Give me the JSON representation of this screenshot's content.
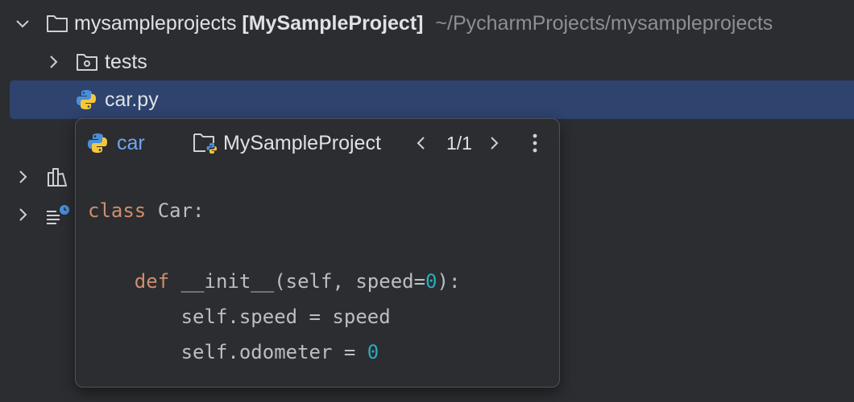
{
  "tree": {
    "root": {
      "name": "mysampleprojects",
      "module": "[MySampleProject]",
      "path": "~/PycharmProjects/mysampleprojects"
    },
    "items": [
      {
        "label": "tests",
        "icon": "test-folder-icon",
        "expanded": false
      },
      {
        "label": "car.py",
        "icon": "python-file-icon",
        "selected": true
      }
    ],
    "collapsed_nodes": [
      {
        "icon": "external-libraries-icon"
      },
      {
        "icon": "scratches-and-consoles-icon"
      }
    ]
  },
  "popup": {
    "symbol": "car",
    "project": "MySampleProject",
    "counter": "1/1",
    "code_lines": [
      {
        "kw": "class",
        "rest": " Car:"
      },
      {
        "text": ""
      },
      {
        "indent": "    ",
        "kw": "def",
        "pre": " __init__(self, speed=",
        "num": "0",
        "post": "):"
      },
      {
        "text": "        self.speed = speed"
      },
      {
        "pre": "        self.odometer = ",
        "num": "0"
      }
    ]
  },
  "colors": {
    "background": "#2b2d30",
    "selection": "#2e436e",
    "keyword": "#cf8e6d",
    "number": "#2aacb8",
    "symbol_link": "#6ea6f5"
  }
}
